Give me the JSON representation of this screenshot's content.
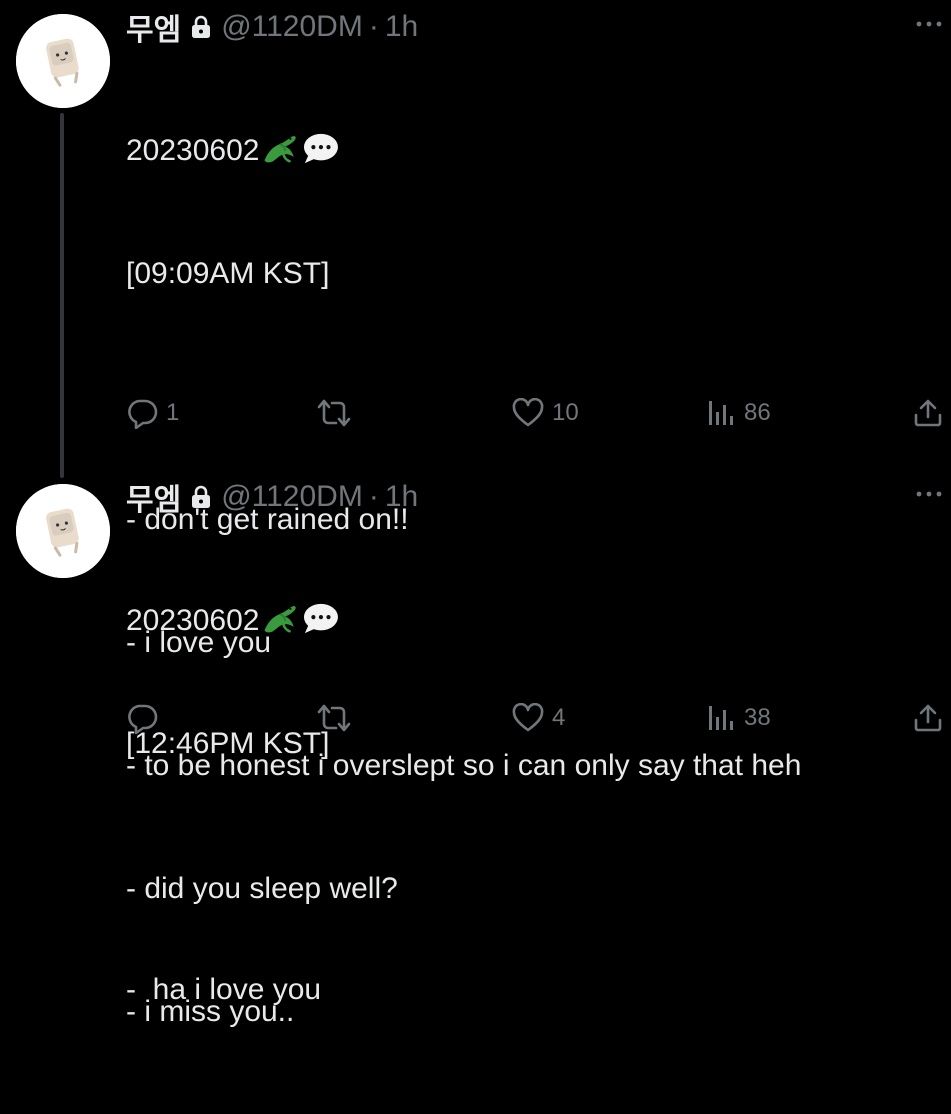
{
  "colors": {
    "background": "#000000",
    "text_primary": "#e7e9ea",
    "text_secondary": "#71767b",
    "thread_line": "#333639"
  },
  "tweets": [
    {
      "display_name": "무엠",
      "protected_icon": "lock-icon",
      "handle": "@1120DM",
      "separator": "·",
      "time": "1h",
      "text": {
        "line1": "20230602",
        "line1_emoji": [
          "crocodile-emoji",
          "speech-balloon-emoji"
        ],
        "line2": "[09:09AM KST]",
        "line3": "",
        "line4": "- don't get rained on!!",
        "line5": "- i love you",
        "line6": "- to be honest i overslept so i can only say that heh",
        "line7": "- did you sleep well?",
        "line8": "- i miss you.."
      },
      "actions": {
        "reply_count": "1",
        "retweet_count": "",
        "like_count": "10",
        "views_count": "86"
      }
    },
    {
      "display_name": "무엠",
      "protected_icon": "lock-icon",
      "handle": "@1120DM",
      "separator": "·",
      "time": "1h",
      "text": {
        "line1": "20230602",
        "line1_emoji": [
          "crocodile-emoji",
          "speech-balloon-emoji"
        ],
        "line2": "[12:46PM KST]",
        "line3": "",
        "line4": "-  ha i love you"
      },
      "actions": {
        "reply_count": "",
        "retweet_count": "",
        "like_count": "4",
        "views_count": "38"
      }
    }
  ]
}
